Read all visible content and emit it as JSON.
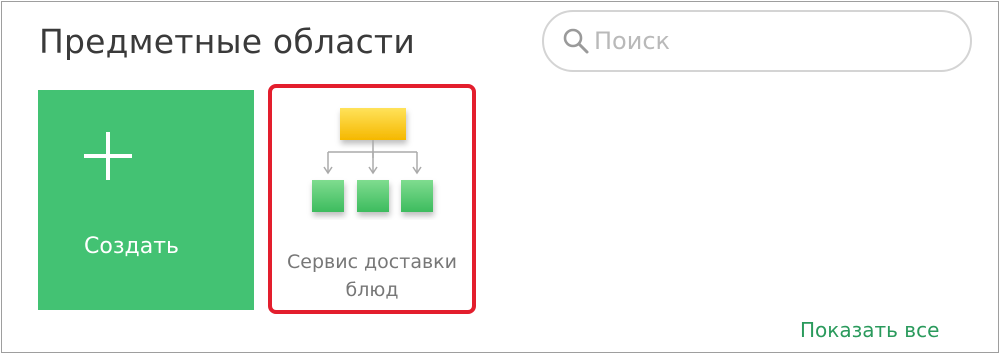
{
  "header": {
    "title": "Предметные области"
  },
  "search": {
    "placeholder": "Поиск",
    "value": "",
    "icon": "search-icon"
  },
  "tiles": {
    "create": {
      "label": "Создать",
      "icon": "plus-icon",
      "color": "#43c273"
    },
    "domain": {
      "label_line1": "Сервис доставки",
      "label_line2": "блюд",
      "icon": "hierarchy-icon",
      "selected": true,
      "highlight_color": "#e31e2d"
    }
  },
  "footer": {
    "show_all_label": "Показать все"
  }
}
